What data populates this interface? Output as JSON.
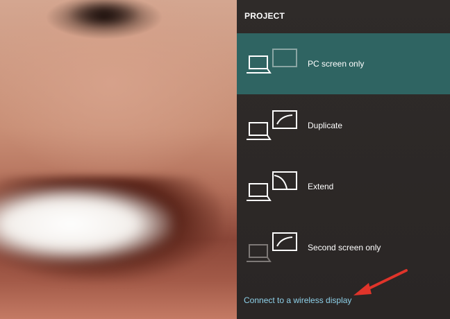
{
  "panel": {
    "title": "PROJECT",
    "options": [
      {
        "label": "PC screen only",
        "icon": "pc-screen-only-icon",
        "selected": true
      },
      {
        "label": "Duplicate",
        "icon": "duplicate-icon",
        "selected": false
      },
      {
        "label": "Extend",
        "icon": "extend-icon",
        "selected": false
      },
      {
        "label": "Second screen only",
        "icon": "second-screen-only-icon",
        "selected": false
      }
    ],
    "connect_link": "Connect to a wireless display"
  },
  "colors": {
    "selected_bg": "#2f6462",
    "link": "#8ed1ea",
    "annotation_arrow": "#e0342a"
  }
}
